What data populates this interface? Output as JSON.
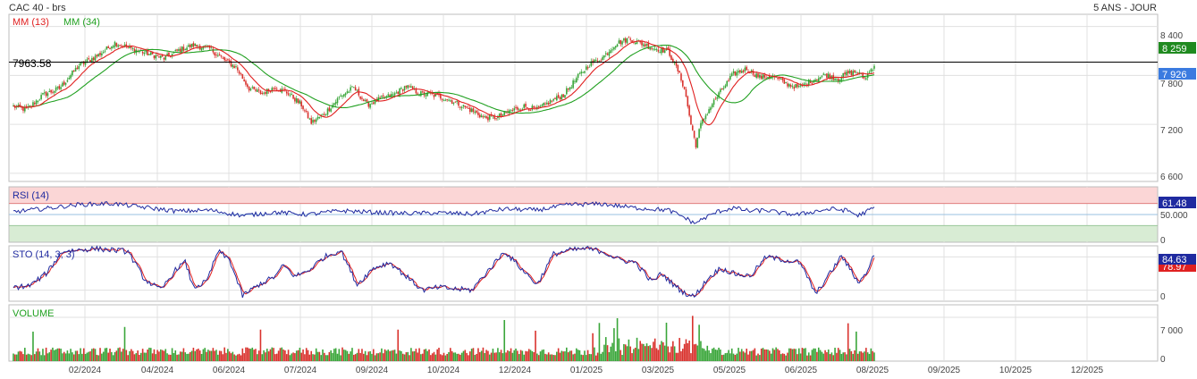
{
  "header": {
    "title": "CAC 40 - brs",
    "period": "5 ANS - JOUR"
  },
  "colors": {
    "grid": "#e0e0e0",
    "border": "#bdbdbd",
    "up": "#3aa63a",
    "down": "#d9322d",
    "ma13": "#e02020",
    "ma34": "#20a020",
    "rsi": "#1f2aa0",
    "sto_k": "#1f2aa0",
    "sto_d": "#e02020",
    "overbought_bg": "#fbd6d6",
    "oversold_bg": "#d8ecd4",
    "price_badge": "#3b7be0",
    "ma34_badge": "#1f8a1f",
    "rsi_badge": "#1f2aa0",
    "sto_badge": "#1f2aa0",
    "sto_d_badge": "#e02020"
  },
  "chart_data": [
    {
      "panel": "price",
      "type": "candlestick",
      "legend": [
        {
          "label": "MM (13)",
          "color": "#e02020"
        },
        {
          "label": "MM (34)",
          "color": "#20a020"
        }
      ],
      "ylim": [
        6500,
        8550
      ],
      "y_ticks": [
        "8 400",
        "7 800",
        "7 200",
        "6 600"
      ],
      "y_tick_values": [
        8400,
        7800,
        7200,
        6600
      ],
      "x_ticks": [
        "02/2024",
        "04/2024",
        "06/2024",
        "07/2024",
        "09/2024",
        "10/2024",
        "12/2024",
        "01/2025",
        "03/2025",
        "05/2025",
        "06/2025",
        "08/2025",
        "09/2025",
        "10/2025",
        "12/2025"
      ],
      "reference_line": {
        "value": 7963.58,
        "label": "7963.58"
      },
      "last_price": {
        "value": 7926,
        "label": "7 926"
      },
      "ma34_last": {
        "value": 8259,
        "label": "8 259"
      },
      "close_anchors": [
        [
          0,
          7420
        ],
        [
          8,
          7380
        ],
        [
          18,
          7560
        ],
        [
          28,
          7640
        ],
        [
          40,
          7920
        ],
        [
          52,
          8050
        ],
        [
          62,
          8200
        ],
        [
          72,
          8130
        ],
        [
          80,
          8080
        ],
        [
          92,
          8010
        ],
        [
          102,
          8120
        ],
        [
          110,
          8170
        ],
        [
          120,
          8130
        ],
        [
          128,
          8000
        ],
        [
          136,
          7900
        ],
        [
          144,
          7640
        ],
        [
          152,
          7580
        ],
        [
          160,
          7660
        ],
        [
          168,
          7580
        ],
        [
          176,
          7440
        ],
        [
          182,
          7220
        ],
        [
          190,
          7330
        ],
        [
          200,
          7550
        ],
        [
          208,
          7650
        ],
        [
          216,
          7440
        ],
        [
          224,
          7510
        ],
        [
          232,
          7560
        ],
        [
          240,
          7670
        ],
        [
          248,
          7580
        ],
        [
          256,
          7560
        ],
        [
          264,
          7520
        ],
        [
          272,
          7450
        ],
        [
          280,
          7370
        ],
        [
          288,
          7280
        ],
        [
          296,
          7290
        ],
        [
          304,
          7370
        ],
        [
          312,
          7420
        ],
        [
          320,
          7380
        ],
        [
          328,
          7480
        ],
        [
          336,
          7560
        ],
        [
          344,
          7760
        ],
        [
          352,
          7940
        ],
        [
          360,
          8020
        ],
        [
          368,
          8190
        ],
        [
          376,
          8250
        ],
        [
          384,
          8190
        ],
        [
          392,
          8130
        ],
        [
          400,
          8100
        ],
        [
          406,
          7860
        ],
        [
          410,
          7640
        ],
        [
          414,
          7200
        ],
        [
          417,
          6950
        ],
        [
          420,
          7200
        ],
        [
          426,
          7420
        ],
        [
          432,
          7600
        ],
        [
          440,
          7820
        ],
        [
          448,
          7880
        ],
        [
          456,
          7780
        ],
        [
          464,
          7790
        ],
        [
          472,
          7700
        ],
        [
          480,
          7650
        ],
        [
          488,
          7740
        ],
        [
          496,
          7810
        ],
        [
          504,
          7760
        ],
        [
          510,
          7830
        ],
        [
          516,
          7840
        ],
        [
          520,
          7760
        ],
        [
          526,
          7930
        ]
      ],
      "n_candles": 527
    },
    {
      "panel": "rsi",
      "type": "line",
      "legend": [
        {
          "label": "RSI (14)",
          "color": "#1f2aa0"
        }
      ],
      "ylim": [
        0,
        100
      ],
      "y_ticks": [
        "50.000",
        "0"
      ],
      "y_tick_values": [
        50,
        0
      ],
      "bands": {
        "overbought": 70,
        "oversold": 30
      },
      "last": {
        "value": 61.48,
        "label": "61.48"
      },
      "anchors": [
        [
          0,
          55
        ],
        [
          20,
          61
        ],
        [
          40,
          68
        ],
        [
          60,
          70
        ],
        [
          80,
          63
        ],
        [
          100,
          56
        ],
        [
          120,
          58
        ],
        [
          140,
          48
        ],
        [
          160,
          54
        ],
        [
          180,
          50
        ],
        [
          200,
          57
        ],
        [
          220,
          54
        ],
        [
          240,
          52
        ],
        [
          260,
          53
        ],
        [
          280,
          51
        ],
        [
          300,
          60
        ],
        [
          320,
          58
        ],
        [
          340,
          68
        ],
        [
          360,
          69
        ],
        [
          380,
          62
        ],
        [
          400,
          58
        ],
        [
          410,
          45
        ],
        [
          416,
          34
        ],
        [
          420,
          40
        ],
        [
          430,
          55
        ],
        [
          440,
          62
        ],
        [
          450,
          56
        ],
        [
          460,
          58
        ],
        [
          470,
          52
        ],
        [
          480,
          50
        ],
        [
          490,
          56
        ],
        [
          500,
          60
        ],
        [
          510,
          57
        ],
        [
          516,
          48
        ],
        [
          526,
          62
        ]
      ]
    },
    {
      "panel": "sto",
      "type": "line",
      "legend": [
        {
          "label": "STO (14, 3, 3)",
          "color": "#1f2aa0"
        }
      ],
      "ylim": [
        0,
        100
      ],
      "y_ticks": [
        "0"
      ],
      "y_tick_values": [
        0
      ],
      "last_k": {
        "value": 84.63,
        "label": "84.63"
      },
      "last_d": {
        "value": 78.97,
        "label": "78.97"
      },
      "anchors": [
        [
          0,
          25
        ],
        [
          10,
          28
        ],
        [
          20,
          50
        ],
        [
          30,
          90
        ],
        [
          50,
          95
        ],
        [
          70,
          90
        ],
        [
          80,
          40
        ],
        [
          90,
          20
        ],
        [
          100,
          60
        ],
        [
          105,
          70
        ],
        [
          110,
          25
        ],
        [
          118,
          35
        ],
        [
          125,
          90
        ],
        [
          132,
          75
        ],
        [
          140,
          10
        ],
        [
          150,
          30
        ],
        [
          160,
          45
        ],
        [
          165,
          65
        ],
        [
          172,
          45
        ],
        [
          180,
          55
        ],
        [
          190,
          80
        ],
        [
          200,
          92
        ],
        [
          210,
          30
        ],
        [
          220,
          60
        ],
        [
          230,
          70
        ],
        [
          240,
          45
        ],
        [
          250,
          20
        ],
        [
          260,
          25
        ],
        [
          270,
          22
        ],
        [
          280,
          20
        ],
        [
          300,
          90
        ],
        [
          310,
          60
        ],
        [
          320,
          30
        ],
        [
          330,
          85
        ],
        [
          340,
          92
        ],
        [
          350,
          95
        ],
        [
          360,
          90
        ],
        [
          370,
          75
        ],
        [
          380,
          70
        ],
        [
          390,
          35
        ],
        [
          396,
          50
        ],
        [
          404,
          28
        ],
        [
          410,
          15
        ],
        [
          416,
          8
        ],
        [
          424,
          40
        ],
        [
          432,
          60
        ],
        [
          440,
          50
        ],
        [
          450,
          45
        ],
        [
          460,
          80
        ],
        [
          470,
          75
        ],
        [
          480,
          70
        ],
        [
          486,
          40
        ],
        [
          490,
          12
        ],
        [
          500,
          55
        ],
        [
          506,
          82
        ],
        [
          516,
          35
        ],
        [
          520,
          45
        ],
        [
          526,
          84
        ]
      ]
    },
    {
      "panel": "volume",
      "type": "bar",
      "legend": [
        {
          "label": "VOLUME",
          "color": "#20a020"
        }
      ],
      "ylim": [
        0,
        9000
      ],
      "y_ticks": [
        "7 000",
        "0"
      ],
      "y_tick_values": [
        7000,
        0
      ]
    }
  ]
}
